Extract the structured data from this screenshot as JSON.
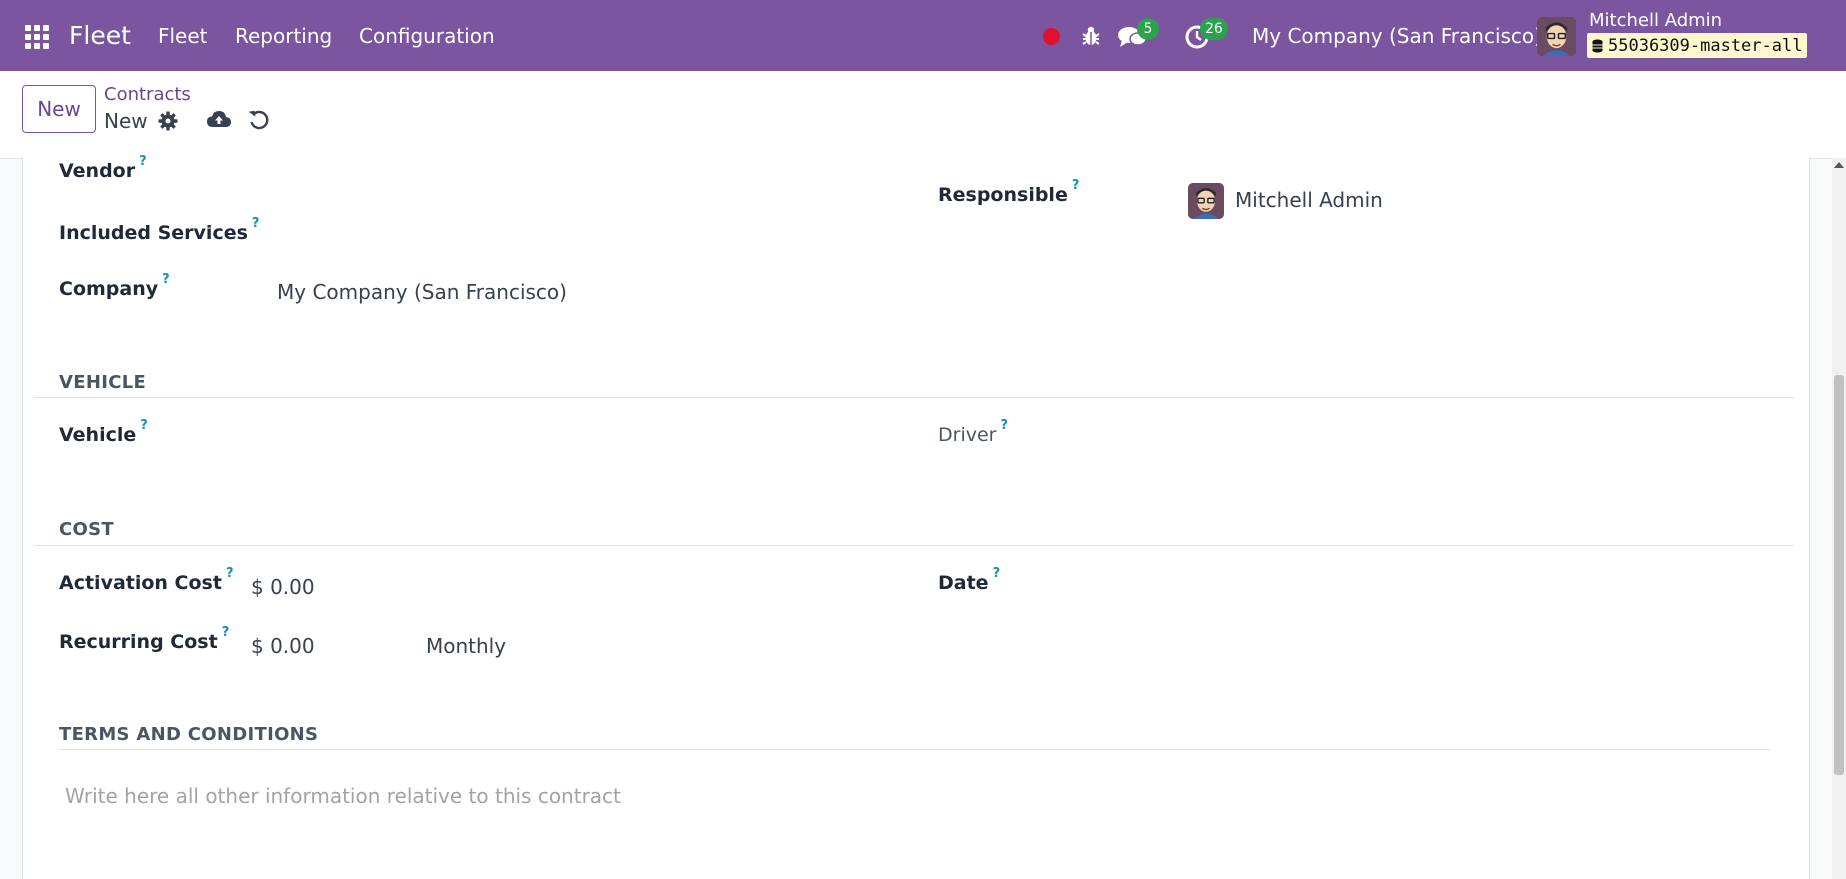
{
  "navbar": {
    "app_name": "Fleet",
    "menu": [
      "Fleet",
      "Reporting",
      "Configuration"
    ],
    "messages_count": "5",
    "activities_count": "26",
    "company": "My Company (San Francisco)",
    "user_name": "Mitchell Admin",
    "database": "55036309-master-all",
    "colors": {
      "navbar": "#7c55a0",
      "badge": "#2aa34a",
      "recording_dot": "#e0102e"
    },
    "icons": [
      "apps-grid-icon",
      "record-icon",
      "bug-icon",
      "chat-icon",
      "clock-icon",
      "database-icon"
    ]
  },
  "control_panel": {
    "new_button": "New",
    "breadcrumb_parent": "Contracts",
    "breadcrumb_current": "New",
    "icons": [
      "gear-icon",
      "cloud-upload-icon",
      "undo-icon"
    ]
  },
  "form": {
    "help_marker": "?",
    "vendor_label": "Vendor",
    "included_services_label": "Included Services",
    "company_label": "Company",
    "company_value": "My Company (San Francisco)",
    "responsible_label": "Responsible",
    "responsible_value": "Mitchell Admin",
    "vehicle_section": "VEHICLE",
    "vehicle_label": "Vehicle",
    "driver_label": "Driver",
    "cost_section": "COST",
    "activation_cost_label": "Activation Cost",
    "activation_cost_value": "$ 0.00",
    "recurring_cost_label": "Recurring Cost",
    "recurring_cost_value": "$ 0.00",
    "recurring_frequency": "Monthly",
    "date_label": "Date",
    "terms_section": "TERMS AND CONDITIONS",
    "terms_placeholder": "Write here all other information relative to this contract"
  }
}
